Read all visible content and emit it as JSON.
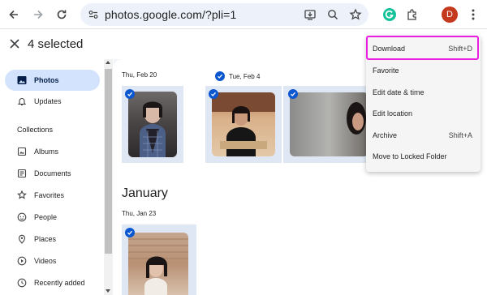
{
  "browser": {
    "url": "photos.google.com/?pli=1",
    "avatar_letter": "D"
  },
  "header": {
    "selected_count": "4 selected"
  },
  "sidebar": {
    "items": [
      {
        "label": "Photos"
      },
      {
        "label": "Updates"
      }
    ],
    "collections_heading": "Collections",
    "collections": [
      {
        "label": "Albums"
      },
      {
        "label": "Documents"
      },
      {
        "label": "Favorites"
      },
      {
        "label": "People"
      },
      {
        "label": "Places"
      },
      {
        "label": "Videos"
      },
      {
        "label": "Recently added"
      }
    ]
  },
  "photos": {
    "groups": [
      {
        "date": "Thu, Feb 20"
      },
      {
        "date": "Tue, Feb 4"
      }
    ],
    "month": "January",
    "jan_group": {
      "date": "Thu, Jan 23"
    }
  },
  "menu": {
    "items": [
      {
        "label": "Download",
        "shortcut": "Shift+D"
      },
      {
        "label": "Favorite",
        "shortcut": ""
      },
      {
        "label": "Edit date & time",
        "shortcut": ""
      },
      {
        "label": "Edit location",
        "shortcut": ""
      },
      {
        "label": "Archive",
        "shortcut": "Shift+A"
      },
      {
        "label": "Move to Locked Folder",
        "shortcut": ""
      }
    ]
  },
  "colors": {
    "accent": "#0b57d0",
    "active_nav": "#d3e3fd",
    "highlight": "#e91ee0"
  }
}
